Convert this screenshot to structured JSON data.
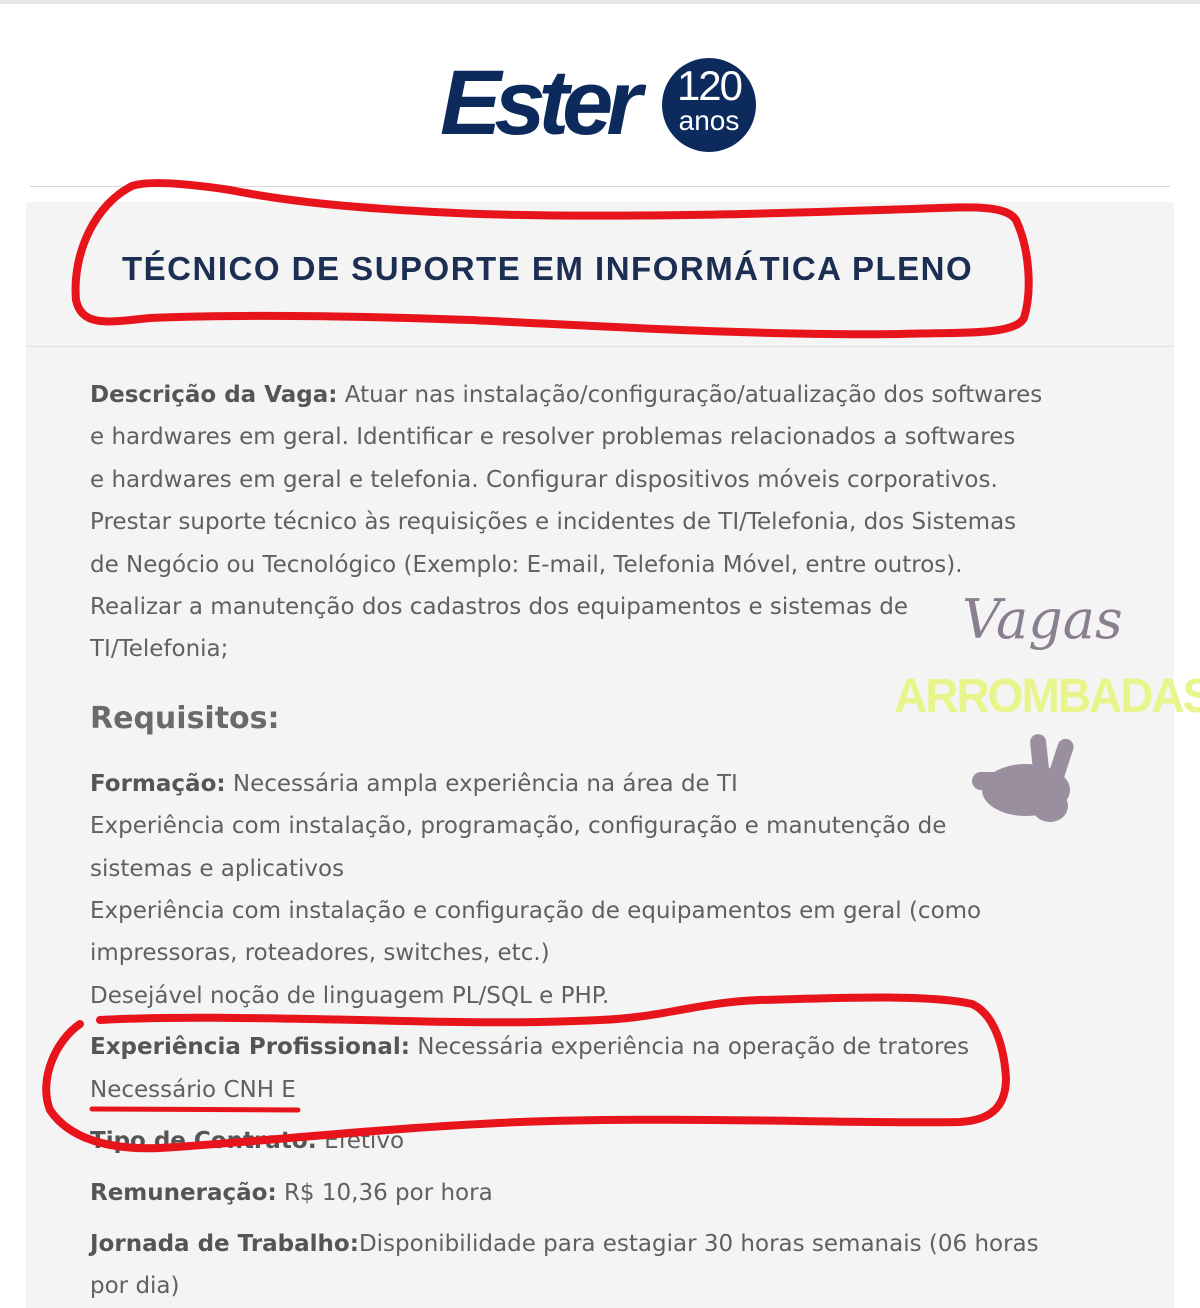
{
  "logo": {
    "wordmark": "Ester",
    "badge_number": "120",
    "badge_text": "anos",
    "color": "#0d2a5c"
  },
  "job": {
    "title": "TÉCNICO DE SUPORTE EM INFORMÁTICA PLENO"
  },
  "description": {
    "label": "Descrição da Vaga:",
    "lines": [
      " Atuar nas instalação/configuração/atualização dos softwares",
      "e hardwares em geral. Identificar e resolver problemas relacionados a softwares",
      "e hardwares em geral e telefonia. Configurar dispositivos móveis corporativos.",
      "Prestar suporte técnico às requisições e incidentes de TI/Telefonia, dos Sistemas",
      "de Negócio ou Tecnológico (Exemplo: E-mail, Telefonia Móvel, entre outros).",
      "Realizar a manutenção dos cadastros dos equipamentos e sistemas de",
      "TI/Telefonia;"
    ]
  },
  "requirements": {
    "heading": "Requisitos:",
    "formacao_label": "Formação:",
    "formacao_lines": [
      " Necessária ampla experiência na área de TI",
      "Experiência com instalação, programação, configuração e manutenção de",
      "sistemas e aplicativos",
      "Experiência com instalação e configuração de equipamentos em geral (como",
      "impressoras, roteadores, switches, etc.)",
      "Desejável noção de linguagem PL/SQL e PHP."
    ],
    "experiencia_label": "Experiência Profissional:",
    "experiencia_lines": [
      " Necessária experiência na operação de tratores",
      "Necessário CNH E"
    ],
    "contrato_label": "Tipo de Contrato:",
    "contrato_value": " Efetivo",
    "remuneracao_label": "Remuneração:",
    "remuneracao_value": " R$ 10,36 por hora",
    "jornada_label": "Jornada de Trabalho:",
    "jornada_lines": [
      "Disponibilidade para estagiar 30 horas semanais (06 horas",
      "por dia)"
    ]
  },
  "watermark": {
    "script_text": "Vagas",
    "bold_text": "ARROMBADAS",
    "hand_icon": "peace-hand-icon"
  },
  "annotations": {
    "color": "#e8141b"
  }
}
